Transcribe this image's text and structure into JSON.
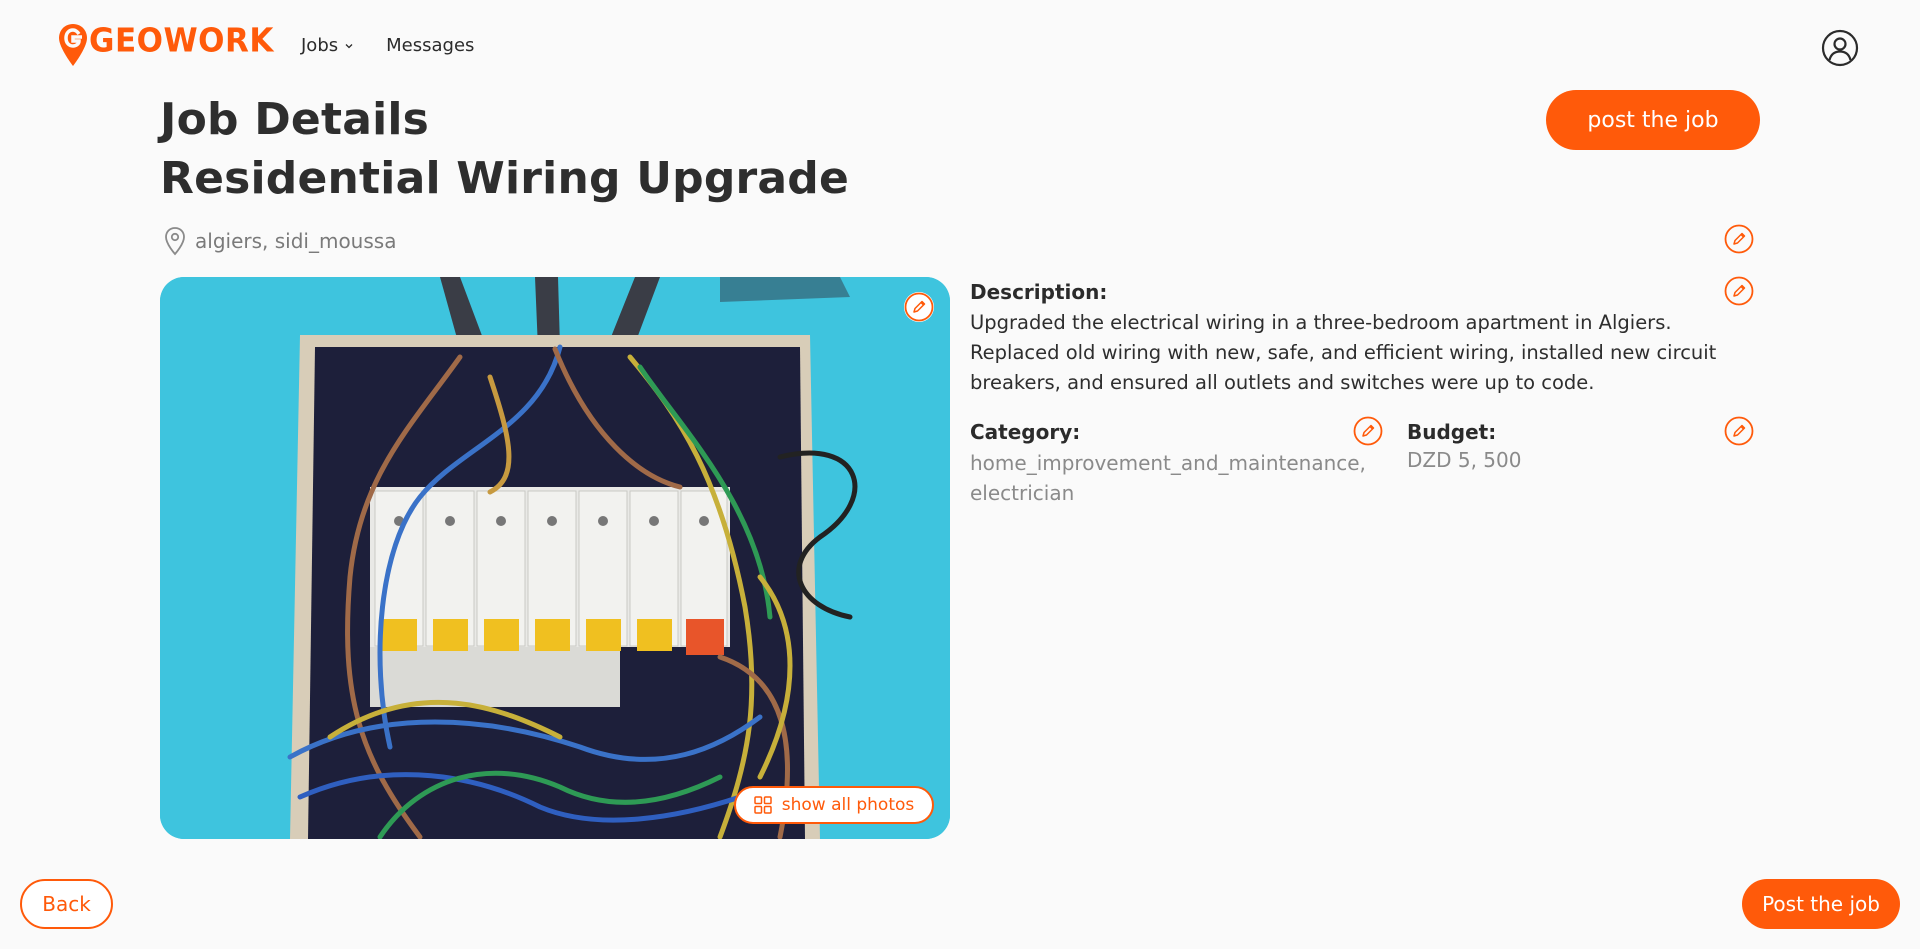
{
  "header": {
    "logo_text": "GEOWORK",
    "nav": [
      {
        "label": "Jobs",
        "has_dropdown": true
      },
      {
        "label": "Messages",
        "has_dropdown": false
      }
    ],
    "user_icon": "user-circle-icon"
  },
  "job": {
    "page_heading": "Job Details",
    "title": "Residential Wiring Upgrade",
    "location": "algiers, sidi_moussa",
    "description_label": "Description:",
    "description": "Upgraded the electrical wiring in a three-bedroom apartment in Algiers. Replaced old wiring with new, safe, and efficient wiring, installed new circuit breakers, and ensured all outlets and switches were up to code.",
    "category_label": "Category:",
    "category_value": "home_improvement_and_maintenance, electrician",
    "budget_label": "Budget:",
    "budget_value": "DZD 5, 500"
  },
  "photo": {
    "show_all_label": "show all photos",
    "show_all_icon": "grid-icon",
    "edit_icon": "pencil-icon"
  },
  "actions": {
    "post_top_label": "post the job",
    "back_label": "Back",
    "post_bottom_label": "Post the job"
  },
  "colors": {
    "accent": "#ff5a0a",
    "background": "#fafafa",
    "muted_text": "#8a8a8a"
  }
}
